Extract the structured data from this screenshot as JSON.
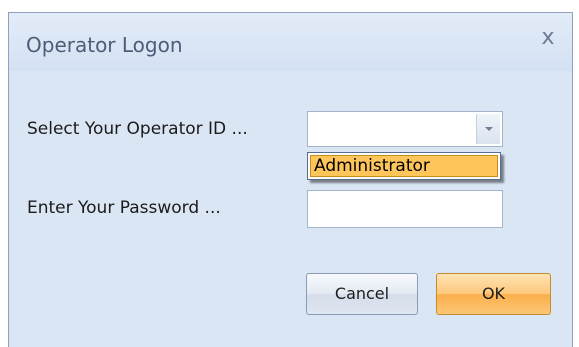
{
  "dialog": {
    "title": "Operator Logon",
    "close_glyph": "x"
  },
  "form": {
    "operator_label": "Select Your Operator ID ...",
    "operator_value": "",
    "operator_options": [
      "Administrator"
    ],
    "highlighted_option": "Administrator",
    "password_label": "Enter Your Password ...",
    "password_value": ""
  },
  "buttons": {
    "cancel_label": "Cancel",
    "ok_label": "OK"
  },
  "icons": {
    "close": "close-icon",
    "dropdown": "chevron-down-icon"
  },
  "colors": {
    "dialog_bg": "#dbe6f5",
    "highlight": "#fdc55a",
    "ok_button": "#fbae4c"
  }
}
